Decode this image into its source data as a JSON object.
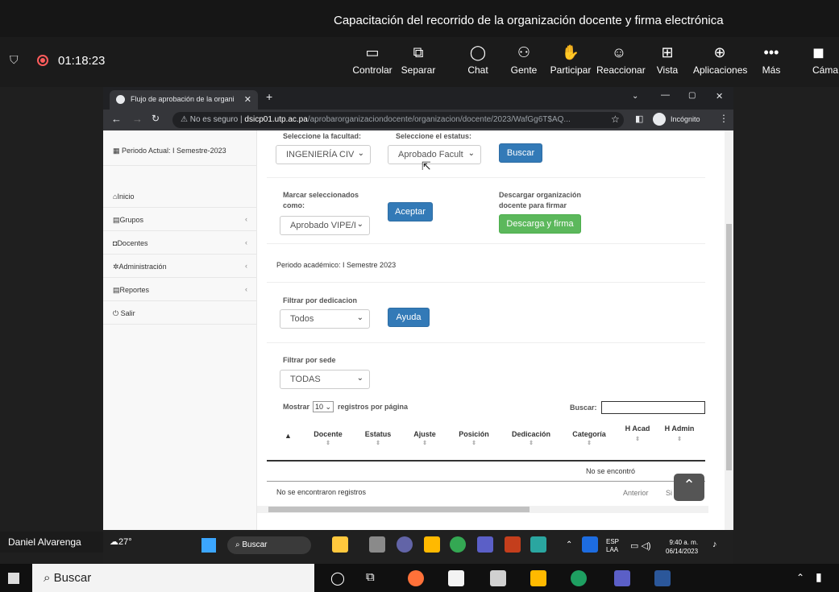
{
  "meeting": {
    "title": "Capacitación del recorrido de la organización docente y firma electrónica",
    "timer": "01:18:23",
    "toolbar": [
      {
        "label": "Controlar",
        "icon": "cast-icon"
      },
      {
        "label": "Separar",
        "icon": "popout-icon"
      },
      {
        "label": "Chat",
        "icon": "chat-icon"
      },
      {
        "label": "Gente",
        "icon": "people-icon"
      },
      {
        "label": "Participar",
        "icon": "hand-icon"
      },
      {
        "label": "Reaccionar",
        "icon": "smile-icon"
      },
      {
        "label": "Vista",
        "icon": "grid-icon"
      },
      {
        "label": "Aplicaciones",
        "icon": "plus-icon"
      },
      {
        "label": "Más",
        "icon": "more-icon"
      },
      {
        "label": "Cáma",
        "icon": "camera-off-icon"
      }
    ],
    "participant_name": "Daniel Alvarenga"
  },
  "browser": {
    "tab_title": "Flujo de aprobación de la organi",
    "security": "No es seguro",
    "host": "dsicp01.utp.ac.pa",
    "path": "/aprobarorganizaciondocente/organizacion/docente/2023/WafGg6T$AQ...",
    "incognito_label": "Incógnito"
  },
  "sidebar": {
    "period": "Periodo Actual: I Semestre-2023",
    "items": [
      {
        "label": "Inicio"
      },
      {
        "label": "Grupos"
      },
      {
        "label": "Docentes"
      },
      {
        "label": "Administración"
      },
      {
        "label": "Reportes"
      },
      {
        "label": "Salir"
      }
    ]
  },
  "filters": {
    "faculty_label": "Seleccione la facultad:",
    "faculty_value": "INGENIERÍA CIV",
    "status_label": "Seleccione el estatus:",
    "status_value": "Aprobado Facult",
    "search_button": "Buscar",
    "mark_label": "Marcar seleccionados como:",
    "mark_value": "Aprobado VIPE/I",
    "accept_button": "Aceptar",
    "download_label": "Descargar organización docente para firmar",
    "download_button": "Descarga y firma",
    "period_text": "Periodo académico: I Semestre 2023",
    "dedication_label": "Filtrar por dedicacion",
    "dedication_value": "Todos",
    "help_button": "Ayuda",
    "site_label": "Filtrar por sede",
    "site_value": "TODAS"
  },
  "table": {
    "show_label": "Mostrar",
    "page_size": "10",
    "per_page_label": "registros por página",
    "search_label": "Buscar:",
    "columns": [
      "Docente",
      "Estatus",
      "Ajuste",
      "Posición",
      "Dedicación",
      "Categoría",
      "H Acad",
      "H Admin"
    ],
    "empty_row": "No se encontró",
    "info": "No se encontraron registros",
    "prev": "Anterior",
    "next": "Si"
  },
  "inner_taskbar": {
    "search": "Buscar",
    "weather": "27°",
    "lang": "ESP",
    "lang2": "LAA",
    "time": "9:40 a. m.",
    "date": "06/14/2023"
  },
  "outer_taskbar": {
    "search": "Buscar"
  }
}
